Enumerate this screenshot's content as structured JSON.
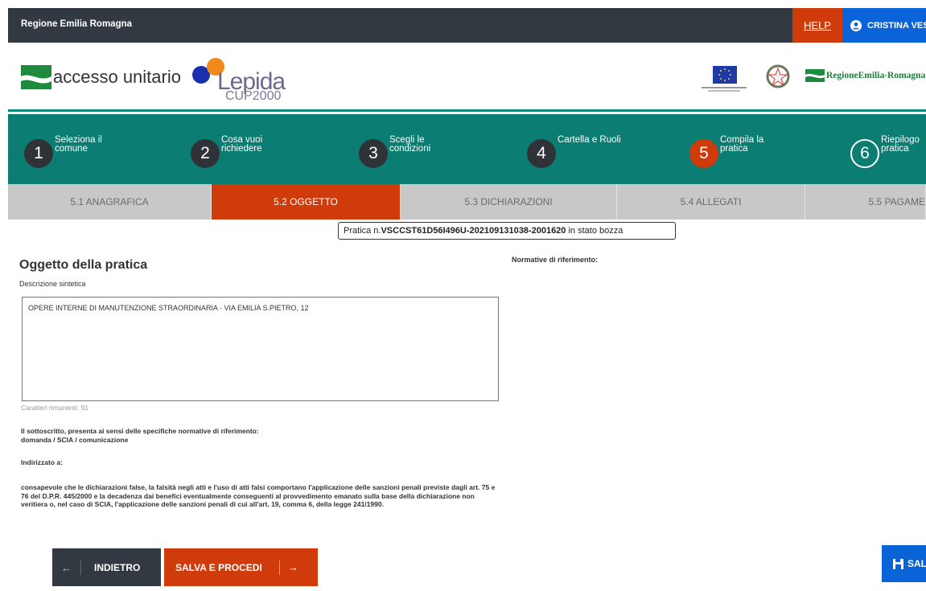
{
  "topbar": {
    "region": "Regione Emilia Romagna",
    "help": "HELP",
    "user": "CRISTINA VES"
  },
  "logos": {
    "accesso": "accesso unitario",
    "lepida": "Lepida",
    "cup": "CUP2000",
    "rer": "RegioneEmilia-Romagna"
  },
  "steps": [
    {
      "num": "1",
      "label": "Seleziona il comune"
    },
    {
      "num": "2",
      "label": "Cosa vuoi richiedere"
    },
    {
      "num": "3",
      "label": "Scegli le condizioni"
    },
    {
      "num": "4",
      "label": "Cartella e Ruoli"
    },
    {
      "num": "5",
      "label": "Compila la pratica"
    },
    {
      "num": "6",
      "label": "Riepilogo pratica"
    }
  ],
  "subtabs": [
    "5.1 ANAGRAFICA",
    "5.2 OGGETTO",
    "5.3 DICHIARAZIONI",
    "5.4 ALLEGATI",
    "5.5 PAGAME"
  ],
  "pratica": {
    "prefix": "Pratica n.",
    "code": "VSCCST61D56I496U-202109131038-2001620",
    "suffix": " in stato bozza"
  },
  "main": {
    "title": "Oggetto della pratica",
    "desc_label": "Descrizione sintetica",
    "normative": "Normative di riferimento:",
    "desc_value": "OPERE INTERNE DI MANUTENZIONE STRAORDINARIA - VIA EMILIA S.PIETRO, 12",
    "chars_left": "Caratteri rimanenti: 91",
    "p1_line1": "Il sottoscritto, presenta ai sensi delle specifiche normative di riferimento:",
    "p1_line2": "domanda / SCIA / comunicazione",
    "p2": "Indirizzato a:",
    "p3": "consapevole che le dichiarazioni false, la falsità negli atti e l'uso di atti falsi comportano l'applicazione delle sanzioni penali previste dagli art. 75 e 76 del D.P.R. 445/2000 e la decadenza dai benefici eventualmente conseguenti al provvedimento emanato sulla base della dichiarazione non veritiera o, nel caso di SCIA, l'applicazione delle sanzioni penali di cui all'art. 19, comma 6, della legge 241/1990."
  },
  "buttons": {
    "back_arrow": "←",
    "back": "INDIETRO",
    "next": "SALVA E PROCEDI",
    "next_arrow": "→",
    "save": "SAL"
  },
  "colors": {
    "teal": "#0b7d72",
    "orange": "#d03b0b",
    "blue": "#0a64d8",
    "dark": "#333940"
  }
}
